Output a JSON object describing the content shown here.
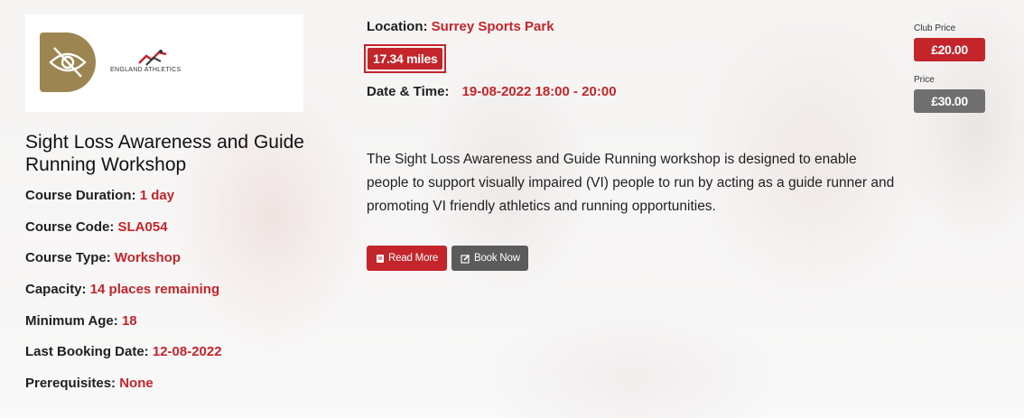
{
  "logos": {
    "primary": "sight-loss-eye-logo",
    "secondary_text": "ENGLAND ATHLETICS"
  },
  "course": {
    "title": "Sight Loss Awareness and Guide Running Workshop",
    "details": [
      {
        "label": "Course Duration:",
        "value": "1 day"
      },
      {
        "label": "Course Code:",
        "value": "SLA054"
      },
      {
        "label": "Course Type:",
        "value": "Workshop"
      },
      {
        "label": "Capacity:",
        "value": "14 places remaining"
      },
      {
        "label": "Minimum Age:",
        "value": "18"
      },
      {
        "label": "Last Booking Date:",
        "value": "12-08-2022"
      },
      {
        "label": "Prerequisites:",
        "value": "None"
      }
    ]
  },
  "location": {
    "label": "Location:",
    "value": "Surrey Sports Park"
  },
  "distance": "17.34 miles",
  "datetime": {
    "label": "Date & Time:",
    "value": "19-08-2022 18:00 - 20:00"
  },
  "description": "The Sight Loss Awareness and Guide Running workshop is designed to enable people to support visually impaired (VI) people to run by acting as a guide runner and promoting VI friendly athletics and running opportunities.",
  "buttons": {
    "read_more": "Read More",
    "book_now": "Book Now"
  },
  "pricing": {
    "club_label": "Club Price",
    "club_value": "£20.00",
    "price_label": "Price",
    "price_value": "£30.00"
  },
  "colors": {
    "accent": "#c3252b",
    "grey_button": "#5b5b5b",
    "logo_gold": "#9c8550"
  }
}
